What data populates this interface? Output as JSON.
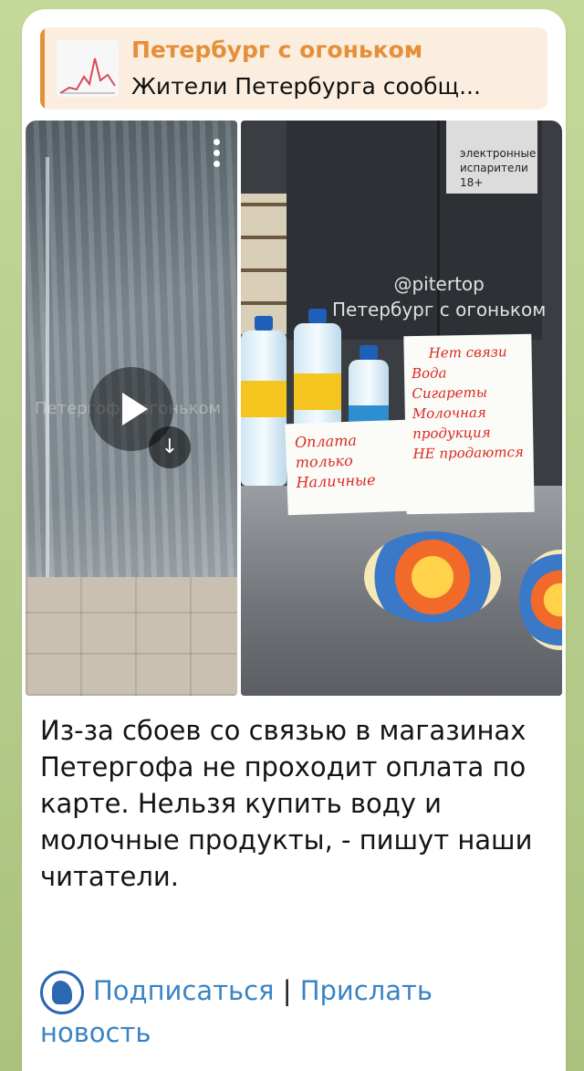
{
  "reply": {
    "title": "Петербург с огоньком",
    "text": "Жители Петербурга сообщ..."
  },
  "media": {
    "left_watermark": "Петергоф с огоньком",
    "right_watermark_line1": "@pitertop",
    "right_watermark_line2": "Петербург с огоньком",
    "cabinet_text": "электронные испарители 18+",
    "sign_big_lines": [
      "Нет связи",
      "Вода",
      "Сигареты",
      "Молочная продукция",
      "НЕ продаются"
    ],
    "sign_small_lines": [
      "Оплата",
      "только",
      "Наличные"
    ],
    "icons": {
      "play": "play-icon",
      "download": "download-icon",
      "menu": "more-vertical-icon"
    }
  },
  "caption": "Из-за сбоев со связью в магазинах Петергофа не проходит оплата по карте. Нельзя купить воду и молочные продукты, - пишут наши читатели.",
  "footer": {
    "subscribe": "Подписаться",
    "separator": "|",
    "send_news": "Прислать новость"
  },
  "colors": {
    "accent_orange": "#e48f3a",
    "link_blue": "#3a84c4"
  }
}
